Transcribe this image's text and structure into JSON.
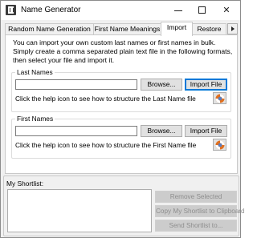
{
  "window": {
    "title": "Name Generator",
    "icon": "app-icon",
    "controls": [
      "minimize-icon",
      "maximize-icon",
      "close-icon"
    ],
    "close_glyph": "✕"
  },
  "tabs": [
    {
      "label": "Random Name Generation",
      "active": false
    },
    {
      "label": "First Name Meanings",
      "active": false
    },
    {
      "label": "Import",
      "active": true
    },
    {
      "label": "Restore",
      "active": false
    }
  ],
  "import": {
    "intro": "You can import your own custom last names or first names in bulk. Simply create a comma separated plain text file in the following formats, then select your file and import it.",
    "last_names": {
      "label": "Last Names",
      "file_value": "",
      "browse_label": "Browse...",
      "import_label": "Import File",
      "hint": "Click the help icon to see how to structure the Last Name file"
    },
    "first_names": {
      "label": "First Names",
      "file_value": "",
      "browse_label": "Browse...",
      "import_label": "Import File",
      "hint": "Click the help icon to see how to structure the First Name file"
    }
  },
  "shortlist": {
    "label": "My Shortlist:",
    "items": [],
    "remove_label": "Remove Selected",
    "copy_label": "Copy My Shortlist to Clipboard",
    "send_label": "Send Shortlist to..."
  },
  "colors": {
    "focus_border": "#0078d7",
    "disabled_text": "#8e8e8e"
  }
}
